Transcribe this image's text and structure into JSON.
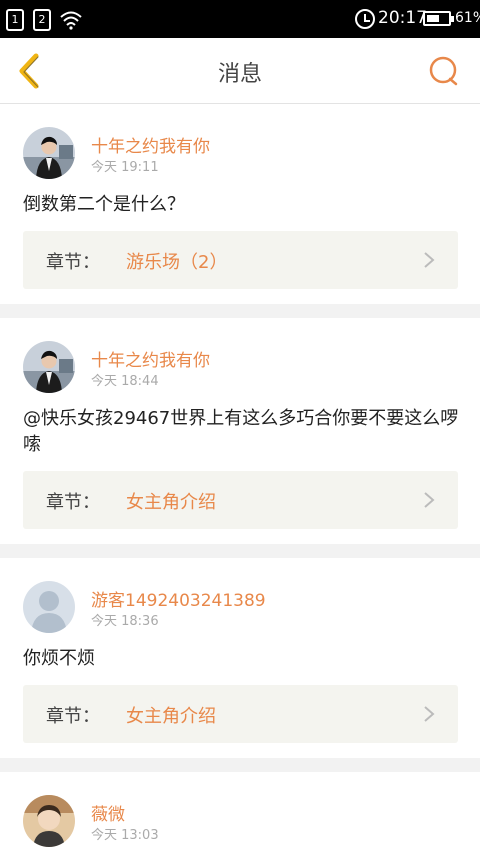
{
  "status_bar": {
    "sim1": "1",
    "sim2": "2",
    "time": "20:17",
    "battery": "61%",
    "battery_level": 0.61
  },
  "header": {
    "title": "消息",
    "back_icon": "chevron-left-icon",
    "search_icon": "search-icon",
    "accent": "#e8884a",
    "back_color": "#f0b514"
  },
  "messages": [
    {
      "user": "十年之约我有你",
      "time": "今天 19:11",
      "text": "倒数第二个是什么？",
      "chapter_label": "章节：",
      "chapter": "游乐场（2）",
      "avatar": "photo"
    },
    {
      "user": "十年之约我有你",
      "time": "今天 18:44",
      "text": "@快乐女孩29467世界上有这么多巧合你要不要这么啰嗦",
      "chapter_label": "章节：",
      "chapter": "女主角介绍",
      "avatar": "photo"
    },
    {
      "user": "游客1492403241389",
      "time": "今天 18:36",
      "text": "你烦不烦",
      "chapter_label": "章节：",
      "chapter": "女主角介绍",
      "avatar": "default"
    },
    {
      "user": "薇微",
      "time": "今天 13:03",
      "avatar": "photo2"
    }
  ]
}
